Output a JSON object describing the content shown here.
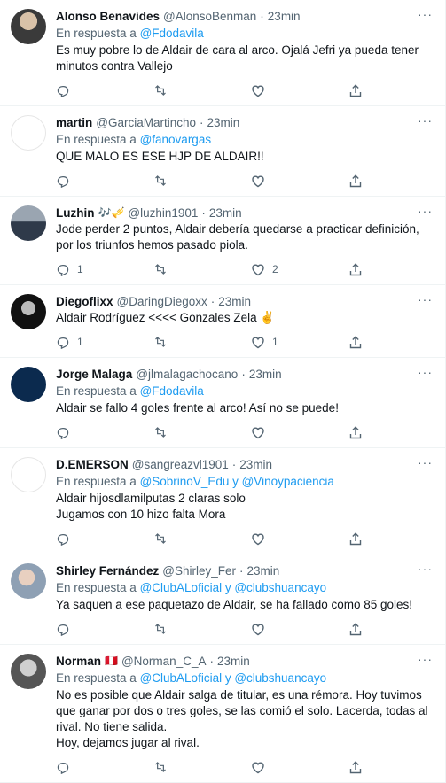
{
  "tweets": [
    {
      "name": "Alonso Benavides",
      "emoji": "",
      "handle": "@AlonsoBenman",
      "time": "23min",
      "reply_prefix": "",
      "reply_to": "",
      "text": "Es muy pobre lo de Aldair de cara al arco. Ojalá Jefri ya pueda tener minutos contra Vallejo",
      "replies": "",
      "retweets": "",
      "likes": ""
    },
    {
      "name": "martin",
      "emoji": "",
      "handle": "@GarciaMartincho",
      "time": "23min",
      "reply_prefix": "En respuesta a",
      "reply_to": "@fanovargas",
      "text": "QUE MALO ES ESE HJP DE ALDAIR!!",
      "replies": "",
      "retweets": "",
      "likes": ""
    },
    {
      "name": "Luzhin",
      "emoji": "🎶🎺",
      "handle": "@luzhin1901",
      "time": "23min",
      "reply_prefix": "",
      "reply_to": "",
      "text": "Jode perder 2 puntos, Aldair debería quedarse a practicar definición, por los triunfos hemos pasado piola.",
      "replies": "1",
      "retweets": "",
      "likes": "2"
    },
    {
      "name": "Diegoflixx",
      "emoji": "",
      "handle": "@DaringDiegoxx",
      "time": "23min",
      "reply_prefix": "",
      "reply_to": "",
      "text": "Aldair Rodríguez <<<< Gonzales Zela ✌️",
      "replies": "1",
      "retweets": "",
      "likes": "1"
    },
    {
      "name": "Jorge Malaga",
      "emoji": "",
      "handle": "@jlmalagachocano",
      "time": "23min",
      "reply_prefix": "En respuesta a",
      "reply_to": "@Fdodavila",
      "text": "Aldair se fallo 4 goles frente al arco! Así no se puede!",
      "replies": "",
      "retweets": "",
      "likes": ""
    },
    {
      "name": "D.EMERSON",
      "emoji": "",
      "handle": "@sangreazvl1901",
      "time": "23min",
      "reply_prefix": "En respuesta a",
      "reply_to": "@SobrinoV_Edu y @Vinoypaciencia",
      "text": "Aldair hijosdlamilputas 2 claras solo\nJugamos con 10 hizo falta Mora",
      "replies": "",
      "retweets": "",
      "likes": ""
    },
    {
      "name": "Shirley Fernández",
      "emoji": "",
      "handle": "@Shirley_Fer",
      "time": "23min",
      "reply_prefix": "En respuesta a",
      "reply_to": "@ClubALoficial y @clubshuancayo",
      "text": "Ya saquen a ese paquetazo de Aldair, se ha fallado como 85 goles!",
      "replies": "",
      "retweets": "",
      "likes": ""
    },
    {
      "name": "Norman",
      "emoji": "🇵🇪",
      "handle": "@Norman_C_A",
      "time": "23min",
      "reply_prefix": "En respuesta a",
      "reply_to": "@ClubALoficial y @clubshuancayo",
      "text": "No es posible que Aldair salga de titular, es una rémora. Hoy tuvimos que ganar por dos o tres goles, se las comió el solo. Lacerda, todas al rival. No tiene salida.\nHoy, dejamos jugar al rival.",
      "replies": "",
      "retweets": "",
      "likes": ""
    }
  ],
  "first_tweet_reply_line": "En respuesta a",
  "first_tweet_reply_to": "@Fdodavila",
  "dot": "·",
  "more_glyph": "···",
  "icons": [
    "reply-icon",
    "retweet-icon",
    "like-icon",
    "share-icon",
    "more-icon"
  ],
  "colors": {
    "link": "#1d9bf0",
    "muted": "#536471",
    "text": "#0f1419",
    "border": "#eff3f4"
  }
}
